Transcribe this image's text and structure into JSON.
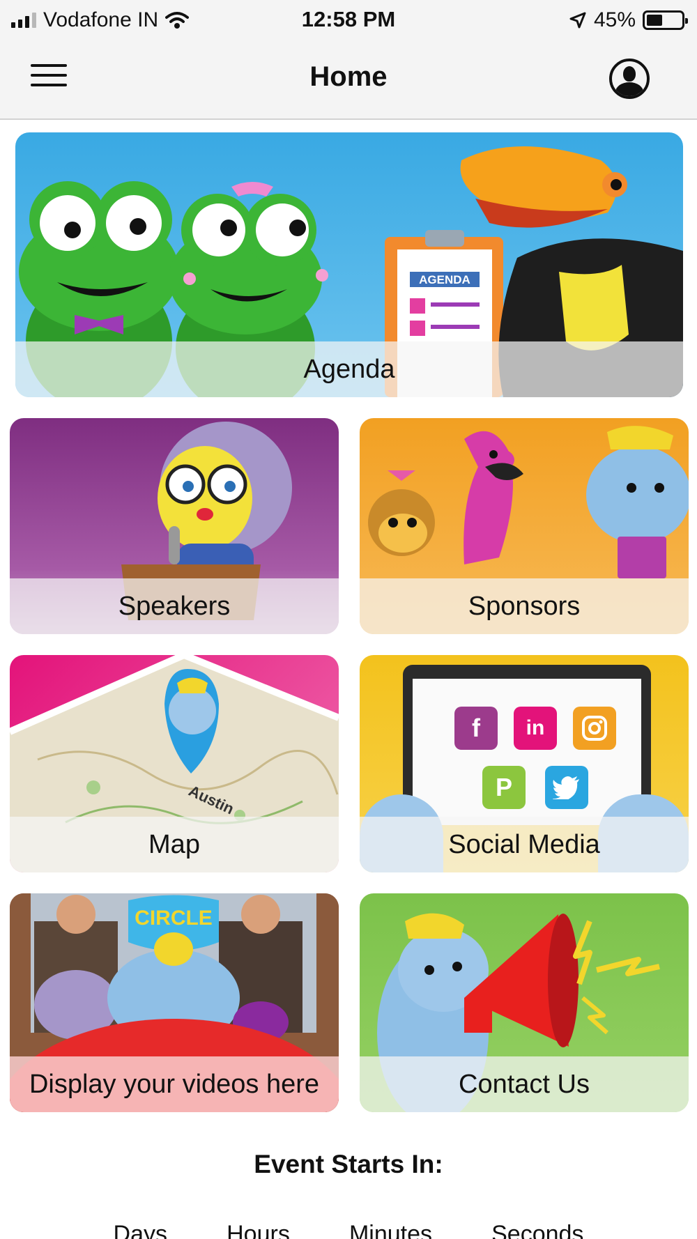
{
  "status_bar": {
    "carrier": "Vodafone IN",
    "time": "12:58 PM",
    "battery_percent": "45%",
    "battery_level": 0.45,
    "icons": [
      "signal-icon",
      "wifi-icon",
      "location-arrow-icon",
      "battery-icon"
    ]
  },
  "nav": {
    "title": "Home",
    "menu_icon": "hamburger-menu-icon",
    "profile_icon": "user-profile-icon"
  },
  "tiles": [
    {
      "id": "agenda",
      "label": "Agenda",
      "board_text": "AGENDA"
    },
    {
      "id": "speakers",
      "label": "Speakers"
    },
    {
      "id": "sponsors",
      "label": "Sponsors"
    },
    {
      "id": "map",
      "label": "Map",
      "map_text": "Austin"
    },
    {
      "id": "social",
      "label": "Social Media",
      "icons": [
        "facebook-icon",
        "linkedin-icon",
        "instagram-icon",
        "pinterest-icon",
        "twitter-icon"
      ]
    },
    {
      "id": "videos",
      "label": "Display your videos here",
      "banner_text": "CIRCLE"
    },
    {
      "id": "contact",
      "label": "Contact Us"
    }
  ],
  "event": {
    "title": "Event Starts In:",
    "countdown_labels": [
      "Days",
      "Hours",
      "Minutes",
      "Seconds"
    ]
  },
  "colors": {
    "bar_background": "#f4f4f4",
    "agenda_sky": "#39a9e3",
    "speakers_purple": "#7f2e81",
    "sponsors_orange": "#f2a022",
    "map_pink": "#e3137a",
    "social_yellow": "#f3c21d",
    "contact_green": "#7cc24a"
  }
}
